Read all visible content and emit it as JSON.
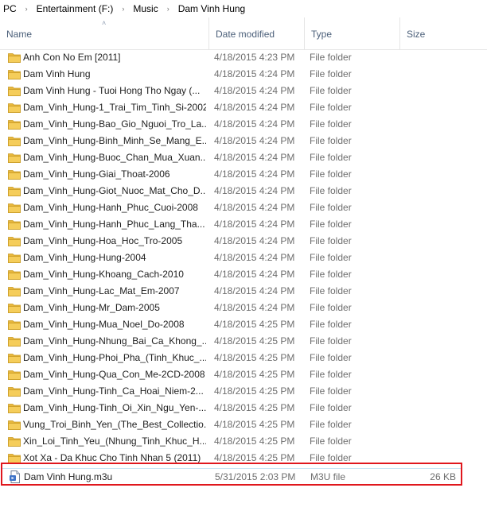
{
  "breadcrumb": [
    "PC",
    "Entertainment (F:)",
    "Music",
    "Dam Vinh Hung"
  ],
  "columns": {
    "name": "Name",
    "date_modified": "Date modified",
    "type": "Type",
    "size": "Size"
  },
  "sort": {
    "column": "name",
    "direction": "ascending"
  },
  "folder_icon_color": "#e8b83d",
  "highlight_color": "#e0171d",
  "files": [
    {
      "name": "Anh Con No Em [2011]",
      "date": "4/18/2015 4:23 PM",
      "type": "File folder",
      "size": ""
    },
    {
      "name": "Dam Vinh Hung",
      "date": "4/18/2015 4:24 PM",
      "type": "File folder",
      "size": ""
    },
    {
      "name": "Dam Vinh Hung - Tuoi Hong Tho Ngay (...",
      "date": "4/18/2015 4:24 PM",
      "type": "File folder",
      "size": ""
    },
    {
      "name": "Dam_Vinh_Hung-1_Trai_Tim_Tinh_Si-2002",
      "date": "4/18/2015 4:24 PM",
      "type": "File folder",
      "size": ""
    },
    {
      "name": "Dam_Vinh_Hung-Bao_Gio_Nguoi_Tro_La...",
      "date": "4/18/2015 4:24 PM",
      "type": "File folder",
      "size": ""
    },
    {
      "name": "Dam_Vinh_Hung-Binh_Minh_Se_Mang_E...",
      "date": "4/18/2015 4:24 PM",
      "type": "File folder",
      "size": ""
    },
    {
      "name": "Dam_Vinh_Hung-Buoc_Chan_Mua_Xuan...",
      "date": "4/18/2015 4:24 PM",
      "type": "File folder",
      "size": ""
    },
    {
      "name": "Dam_Vinh_Hung-Giai_Thoat-2006",
      "date": "4/18/2015 4:24 PM",
      "type": "File folder",
      "size": ""
    },
    {
      "name": "Dam_Vinh_Hung-Giot_Nuoc_Mat_Cho_D...",
      "date": "4/18/2015 4:24 PM",
      "type": "File folder",
      "size": ""
    },
    {
      "name": "Dam_Vinh_Hung-Hanh_Phuc_Cuoi-2008",
      "date": "4/18/2015 4:24 PM",
      "type": "File folder",
      "size": ""
    },
    {
      "name": "Dam_Vinh_Hung-Hanh_Phuc_Lang_Tha...",
      "date": "4/18/2015 4:24 PM",
      "type": "File folder",
      "size": ""
    },
    {
      "name": "Dam_Vinh_Hung-Hoa_Hoc_Tro-2005",
      "date": "4/18/2015 4:24 PM",
      "type": "File folder",
      "size": ""
    },
    {
      "name": "Dam_Vinh_Hung-Hung-2004",
      "date": "4/18/2015 4:24 PM",
      "type": "File folder",
      "size": ""
    },
    {
      "name": "Dam_Vinh_Hung-Khoang_Cach-2010",
      "date": "4/18/2015 4:24 PM",
      "type": "File folder",
      "size": ""
    },
    {
      "name": "Dam_Vinh_Hung-Lac_Mat_Em-2007",
      "date": "4/18/2015 4:24 PM",
      "type": "File folder",
      "size": ""
    },
    {
      "name": "Dam_Vinh_Hung-Mr_Dam-2005",
      "date": "4/18/2015 4:24 PM",
      "type": "File folder",
      "size": ""
    },
    {
      "name": "Dam_Vinh_Hung-Mua_Noel_Do-2008",
      "date": "4/18/2015 4:25 PM",
      "type": "File folder",
      "size": ""
    },
    {
      "name": "Dam_Vinh_Hung-Nhung_Bai_Ca_Khong_...",
      "date": "4/18/2015 4:25 PM",
      "type": "File folder",
      "size": ""
    },
    {
      "name": "Dam_Vinh_Hung-Phoi_Pha_(Tinh_Khuc_...",
      "date": "4/18/2015 4:25 PM",
      "type": "File folder",
      "size": ""
    },
    {
      "name": "Dam_Vinh_Hung-Qua_Con_Me-2CD-2008",
      "date": "4/18/2015 4:25 PM",
      "type": "File folder",
      "size": ""
    },
    {
      "name": "Dam_Vinh_Hung-Tinh_Ca_Hoai_Niem-2...",
      "date": "4/18/2015 4:25 PM",
      "type": "File folder",
      "size": ""
    },
    {
      "name": "Dam_Vinh_Hung-Tinh_Oi_Xin_Ngu_Yen-...",
      "date": "4/18/2015 4:25 PM",
      "type": "File folder",
      "size": ""
    },
    {
      "name": "Vung_Troi_Binh_Yen_(The_Best_Collectio...",
      "date": "4/18/2015 4:25 PM",
      "type": "File folder",
      "size": ""
    },
    {
      "name": "Xin_Loi_Tinh_Yeu_(Nhung_Tinh_Khuc_H...",
      "date": "4/18/2015 4:25 PM",
      "type": "File folder",
      "size": ""
    },
    {
      "name": "Xot Xa - Da Khuc Cho Tinh Nhan 5 (2011)",
      "date": "4/18/2015 4:25 PM",
      "type": "File folder",
      "size": ""
    },
    {
      "name": "Dam Vinh Hung.m3u",
      "date": "5/31/2015 2:03 PM",
      "type": "M3U file",
      "size": "26 KB",
      "icon": "playlist-file-icon",
      "selected": true
    }
  ]
}
